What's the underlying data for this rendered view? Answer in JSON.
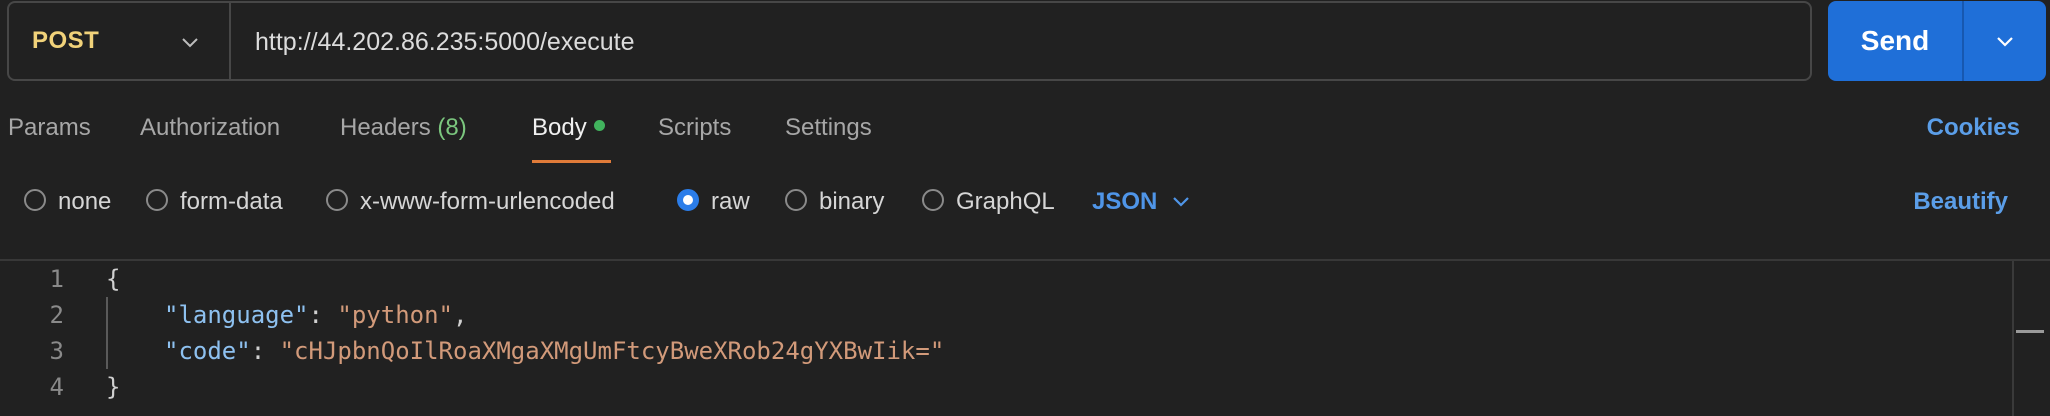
{
  "request": {
    "method": "POST",
    "url": "http://44.202.86.235:5000/execute",
    "send_label": "Send"
  },
  "tabs": [
    {
      "label": "Params"
    },
    {
      "label": "Authorization"
    },
    {
      "label": "Headers",
      "count": "(8)"
    },
    {
      "label": "Body",
      "active": true
    },
    {
      "label": "Scripts"
    },
    {
      "label": "Settings"
    }
  ],
  "cookies_label": "Cookies",
  "body_types": [
    {
      "label": "none"
    },
    {
      "label": "form-data"
    },
    {
      "label": "x-www-form-urlencoded"
    },
    {
      "label": "raw",
      "selected": true
    },
    {
      "label": "binary"
    },
    {
      "label": "GraphQL"
    }
  ],
  "format_select": "JSON",
  "beautify_label": "Beautify",
  "editor": {
    "lines": [
      {
        "no": "1",
        "open": "{"
      },
      {
        "no": "2",
        "key": "\"language\"",
        "sep": ": ",
        "value": "\"python\"",
        "end": ","
      },
      {
        "no": "3",
        "key": "\"code\"",
        "sep": ": ",
        "value": "\"cHJpbnQoIlRoaXMgaXMgUmFtcyBweXRob24gYXBwIik=\"",
        "end": ""
      },
      {
        "no": "4",
        "close": "}"
      }
    ]
  },
  "colors": {
    "method": "#f1d27a",
    "send_bg": "#1f6fd8",
    "accent_link": "#5b9ee8",
    "active_tab_underline": "#e07b39",
    "body_dot": "#41b35d",
    "json_key": "#8ec1f0",
    "json_string": "#d29a7a"
  },
  "icons": [
    "chevron-down-icon",
    "radio-icon"
  ]
}
